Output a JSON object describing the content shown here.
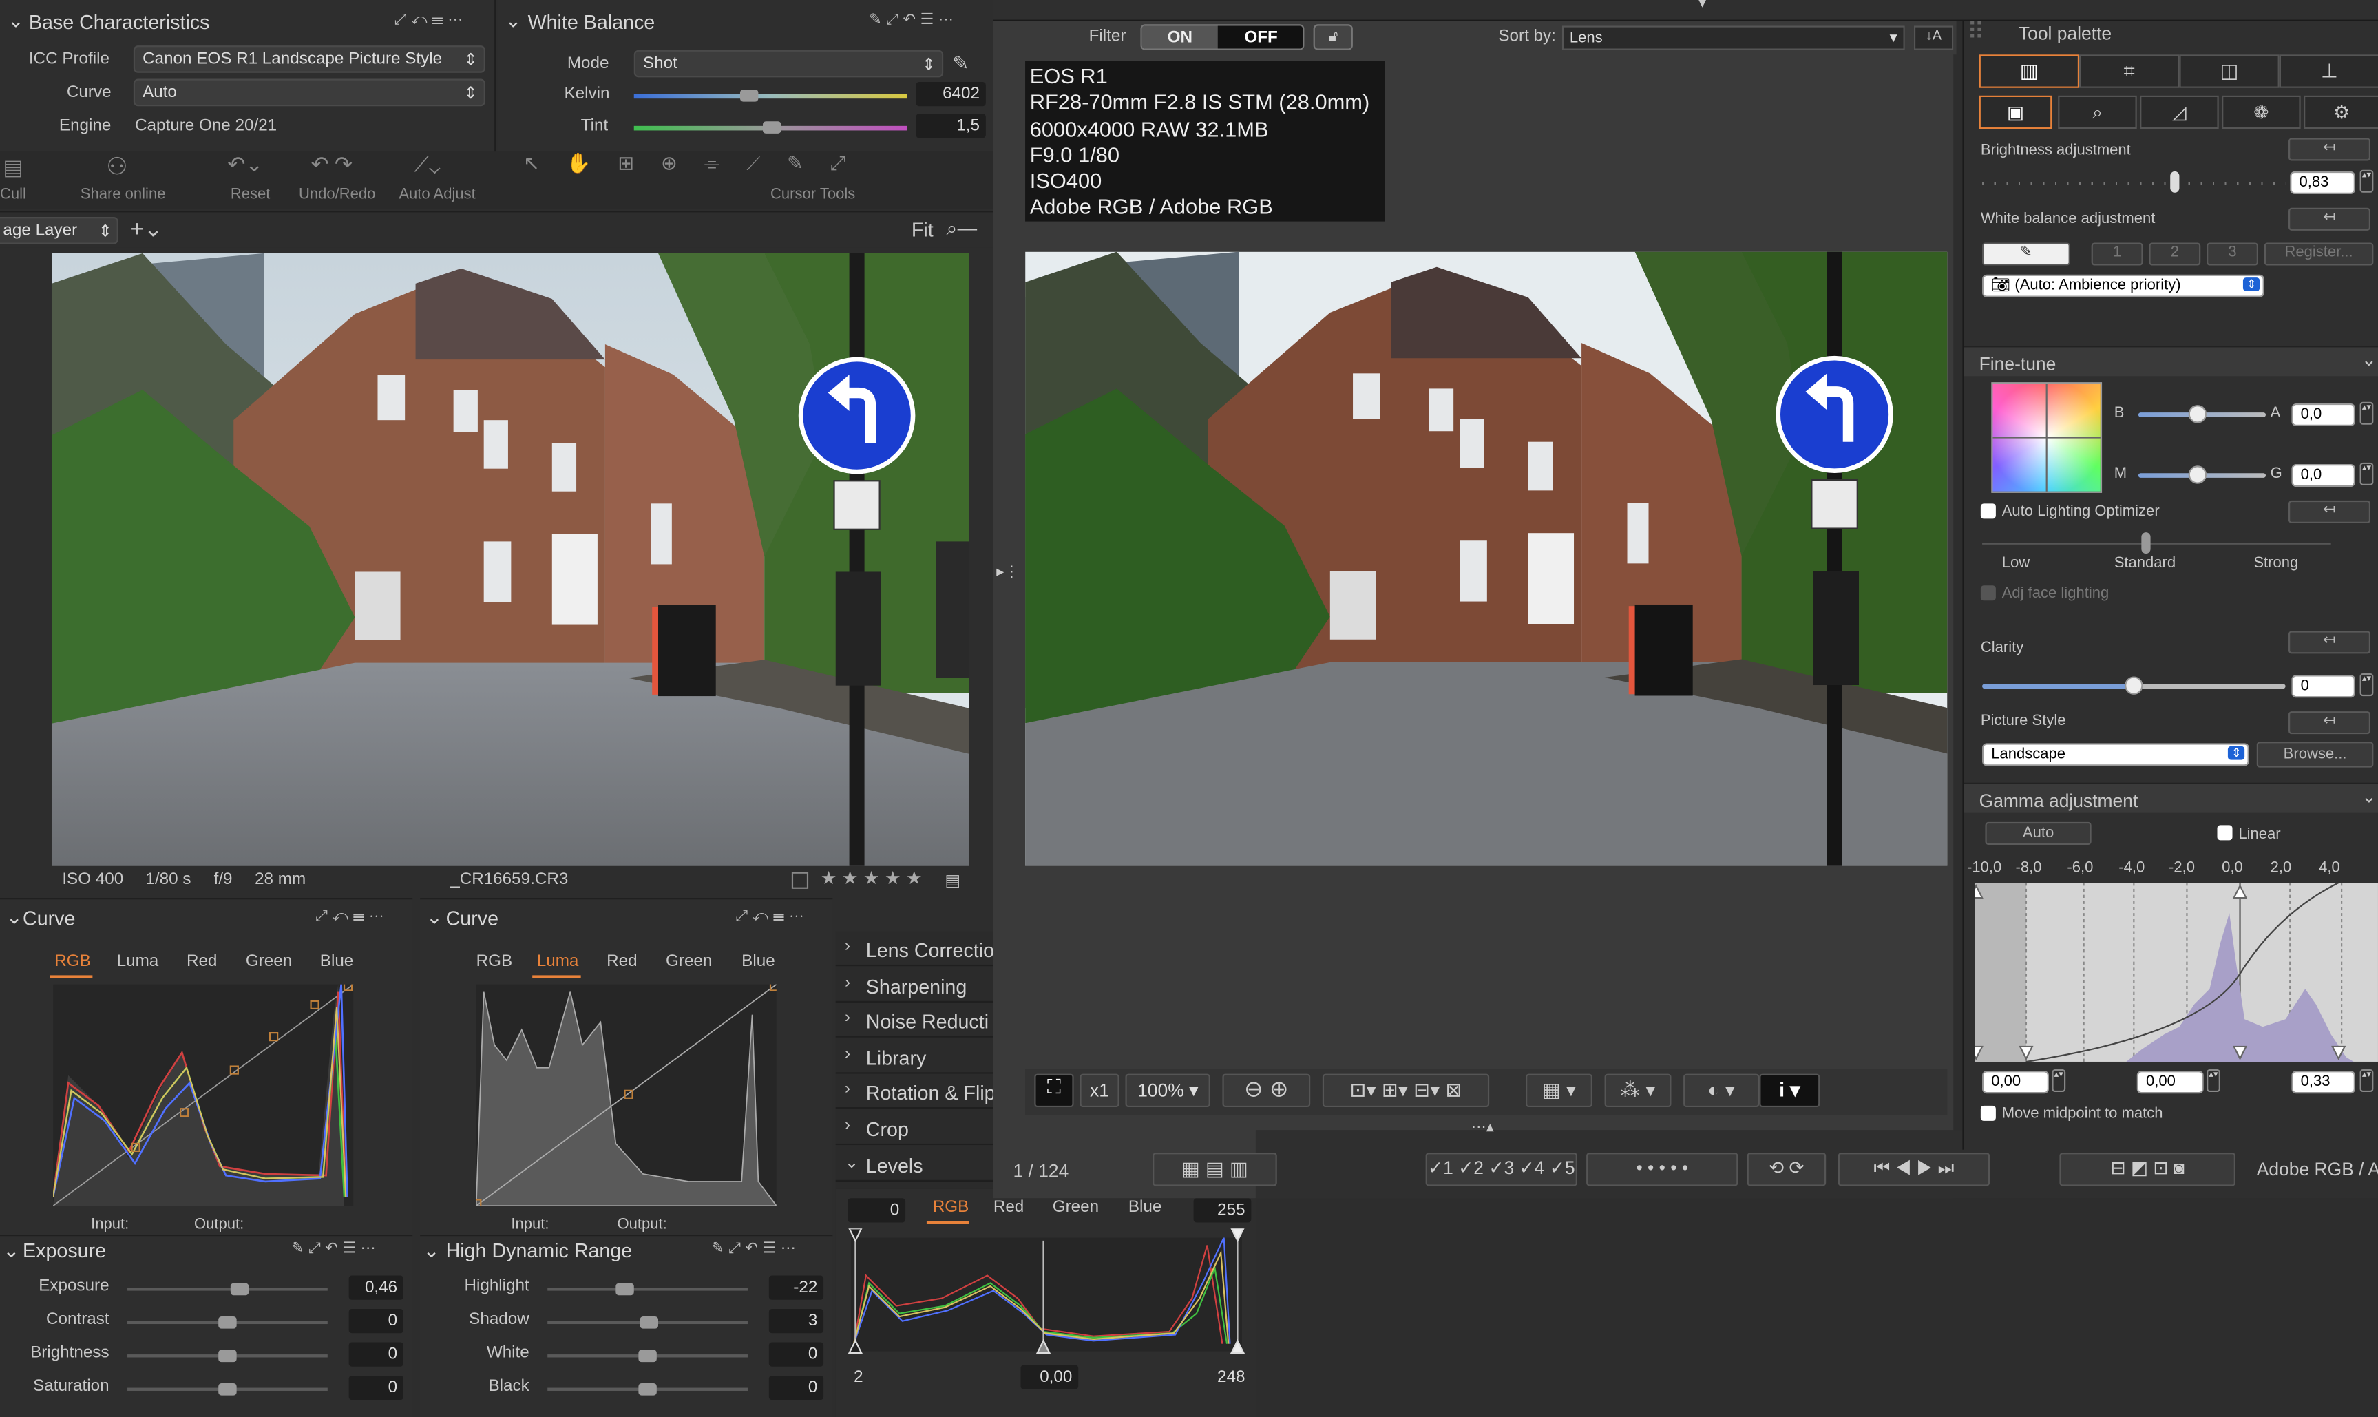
{
  "base": {
    "title": "Base Characteristics",
    "icc_label": "ICC Profile",
    "icc_value": "Canon EOS R1 Landscape Picture Style",
    "curve_label": "Curve",
    "curve_value": "Auto",
    "engine_label": "Engine",
    "engine_value": "Capture One 20/21"
  },
  "wb": {
    "title": "White Balance",
    "mode_label": "Mode",
    "mode_value": "Shot",
    "kelvin_label": "Kelvin",
    "kelvin_value": "6402",
    "tint_label": "Tint",
    "tint_value": "1,5"
  },
  "toolbar": {
    "cull": "Cull",
    "share": "Share online",
    "reset": "Reset",
    "undo": "Undo/Redo",
    "auto": "Auto Adjust",
    "cursor": "Cursor Tools"
  },
  "layer": {
    "label": "age Layer",
    "fit": "Fit"
  },
  "left_meta": {
    "iso": "ISO 400",
    "shutter": "1/80 s",
    "aperture": "f/9",
    "focal": "28 mm",
    "file": "_CR16659.CR3",
    "stars": "★ ★ ★ ★ ★"
  },
  "curve1": {
    "title": "Curve",
    "tabs": [
      "RGB",
      "Luma",
      "Red",
      "Green",
      "Blue"
    ],
    "active": "RGB",
    "input": "Input:",
    "output": "Output:"
  },
  "curve2": {
    "title": "Curve",
    "tabs": [
      "RGB",
      "Luma",
      "Red",
      "Green",
      "Blue"
    ],
    "active": "Luma",
    "input": "Input:",
    "output": "Output:"
  },
  "exposure": {
    "title": "Exposure",
    "rows": [
      {
        "label": "Exposure",
        "value": "0,46",
        "level": 0.56
      },
      {
        "label": "Contrast",
        "value": "0",
        "level": 0.5
      },
      {
        "label": "Brightness",
        "value": "0",
        "level": 0.5
      },
      {
        "label": "Saturation",
        "value": "0",
        "level": 0.5
      }
    ]
  },
  "hdr": {
    "title": "High Dynamic Range",
    "rows": [
      {
        "label": "Highlight",
        "value": "-22",
        "level": 0.39
      },
      {
        "label": "Shadow",
        "value": "3",
        "level": 0.51
      },
      {
        "label": "White",
        "value": "0",
        "level": 0.5
      },
      {
        "label": "Black",
        "value": "0",
        "level": 0.5
      }
    ]
  },
  "tools_list": [
    "Lens Correctio",
    "Sharpening",
    "Noise Reducti",
    "Library",
    "Rotation & Flip",
    "Crop",
    "Levels"
  ],
  "levels": {
    "min_top": "0",
    "max_top": "255",
    "tabs": [
      "RGB",
      "Red",
      "Green",
      "Blue"
    ],
    "min": "2",
    "mid": "0,00",
    "max": "248"
  },
  "viewer": {
    "filter_label": "Filter",
    "on": "ON",
    "off": "OFF",
    "sortby_label": "Sort by:",
    "sortby_value": "Lens",
    "info_lines": [
      "EOS R1",
      "RF28-70mm F2.8 IS STM (28.0mm)",
      "6000x4000 RAW 32.1MB",
      "F9.0 1/80",
      "ISO400",
      "Adobe RGB / Adobe RGB"
    ],
    "zoom_x1": "x1",
    "zoom_pct": "100%",
    "counter": "1 / 124",
    "colorspace": "Adobe RGB / A"
  },
  "palette": {
    "title": "Tool palette",
    "brightness_label": "Brightness adjustment",
    "brightness_value": "0,83",
    "wb_label": "White balance adjustment",
    "wb_slots": [
      "1",
      "2",
      "3"
    ],
    "register": "Register...",
    "wb_select": "(Auto: Ambience priority)",
    "finetune_title": "Fine-tune",
    "b_label": "B",
    "a_label": "A",
    "a_value": "0,0",
    "m_label": "M",
    "g_label": "G",
    "g_value": "0,0",
    "alo_label": "Auto Lighting Optimizer",
    "low": "Low",
    "standard": "Standard",
    "strong": "Strong",
    "adj_face": "Adj face lighting",
    "clarity_label": "Clarity",
    "clarity_value": "0",
    "picstyle_label": "Picture Style",
    "picstyle_value": "Landscape",
    "browse": "Browse...",
    "gamma_title": "Gamma adjustment",
    "auto_btn": "Auto",
    "linear": "Linear",
    "gamma_ticks": [
      "-10,0",
      "-8,0",
      "-6,0",
      "-4,0",
      "-2,0",
      "0,0",
      "2,0",
      "4,0"
    ],
    "gamma_v1": "0,00",
    "gamma_v2": "0,00",
    "gamma_v3": "0,33",
    "move_mid": "Move midpoint to match"
  },
  "colors": {
    "accent_orange": "#e8823a",
    "dpp_blue": "#1c62d6",
    "panel_bg": "#2d2d2d"
  }
}
